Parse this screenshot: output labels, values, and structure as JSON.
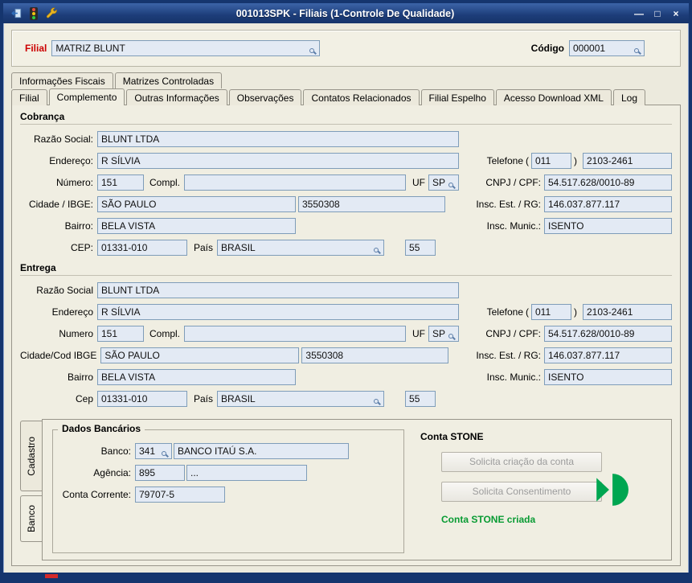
{
  "window": {
    "title": "001013SPK - Filiais (1-Controle De Qualidade)",
    "controls": {
      "minimize": "—",
      "maximize": "□",
      "close": "×"
    }
  },
  "header": {
    "filial_label": "Filial",
    "filial_value": "MATRIZ BLUNT",
    "codigo_label": "Código",
    "codigo_value": "000001"
  },
  "tabs": {
    "row1": [
      {
        "label": "Informações Fiscais"
      },
      {
        "label": "Matrizes Controladas"
      }
    ],
    "row2": [
      {
        "label": "Filial"
      },
      {
        "label": "Complemento"
      },
      {
        "label": "Outras Informações"
      },
      {
        "label": "Observações"
      },
      {
        "label": "Contatos Relacionados"
      },
      {
        "label": "Filial Espelho"
      },
      {
        "label": "Acesso Download XML"
      },
      {
        "label": "Log"
      }
    ],
    "active_tab": "Complemento"
  },
  "cobranca": {
    "title": "Cobrança",
    "fields": {
      "razao_label": "Razão Social:",
      "razao": "BLUNT LTDA",
      "endereco_label": "Endereço:",
      "endereco": "R SÍLVIA",
      "numero_label": "Número:",
      "numero": "151",
      "compl_label": "Compl.",
      "compl": "",
      "uf_label": "UF",
      "uf": "SP",
      "cidade_label": "Cidade / IBGE:",
      "cidade": "SÃO PAULO",
      "ibge": "3550308",
      "bairro_label": "Bairro:",
      "bairro": "BELA VISTA",
      "cep_label": "CEP:",
      "cep": "01331-010",
      "pais_label": "País",
      "pais": "BRASIL",
      "ddi": "55"
    },
    "right": {
      "telefone_label": "Telefone",
      "paren_open": "(",
      "ddd": "011",
      "paren_close": ")",
      "fone": "2103-2461",
      "cnpj_label": "CNPJ / CPF:",
      "cnpj": "54.517.628/0010-89",
      "insc_est_label": "Insc. Est. / RG:",
      "insc_est": "146.037.877.117",
      "insc_mun_label": "Insc. Munic.:",
      "insc_mun": "ISENTO"
    }
  },
  "entrega": {
    "title": "Entrega",
    "fields": {
      "razao_label": "Razão Social",
      "razao": "BLUNT LTDA",
      "endereco_label": "Endereço",
      "endereco": "R SÍLVIA",
      "numero_label": "Numero",
      "numero": "151",
      "compl_label": "Compl.",
      "compl": "",
      "uf_label": "UF",
      "uf": "SP",
      "cidade_label": "Cidade/Cod IBGE",
      "cidade": "SÃO PAULO",
      "ibge": "3550308",
      "bairro_label": "Bairro",
      "bairro": "BELA VISTA",
      "cep_label": "Cep",
      "cep": "01331-010",
      "pais_label": "País",
      "pais": "BRASIL",
      "ddi": "55"
    },
    "right": {
      "telefone_label": "Telefone",
      "paren_open": "(",
      "ddd": "011",
      "paren_close": ")",
      "fone": "2103-2461",
      "cnpj_label": "CNPJ / CPF:",
      "cnpj": "54.517.628/0010-89",
      "insc_est_label": "Insc. Est. / RG:",
      "insc_est": "146.037.877.117",
      "insc_mun_label": "Insc. Munic.:",
      "insc_mun": "ISENTO"
    }
  },
  "bottom": {
    "vtabs": [
      {
        "label": "Cadastro"
      },
      {
        "label": "Banco"
      }
    ],
    "active_vtab": "Banco",
    "dados_bancarios": {
      "title": "Dados Bancários",
      "banco_label": "Banco:",
      "banco_codigo": "341",
      "banco_nome": "BANCO ITAÚ S.A.",
      "agencia_label": "Agência:",
      "agencia": "895",
      "agencia_compl": "...",
      "conta_label": "Conta Corrente:",
      "conta": "79707-5"
    },
    "conta_stone": {
      "title": "Conta STONE",
      "btn_criacao": "Solicita criação da conta",
      "btn_consentimento": "Solicita Consentimento",
      "status": "Conta STONE criada"
    }
  },
  "colors": {
    "frame_blue": "#15356e",
    "titlebar_blue": "#1d3d79",
    "field_bg": "#e3eaf4",
    "field_border": "#7f9db9",
    "filial_label_red": "#cc0000",
    "stone_green": "#00a651",
    "status_green": "#089b33",
    "disabled_button_text": "#9c9c9c"
  },
  "icons": {
    "titlebar": [
      "exit-icon",
      "traffic-light-icon",
      "wrench-icon"
    ],
    "field_lookup": "magnifier-icon",
    "stone": "stone-logo-icon"
  }
}
